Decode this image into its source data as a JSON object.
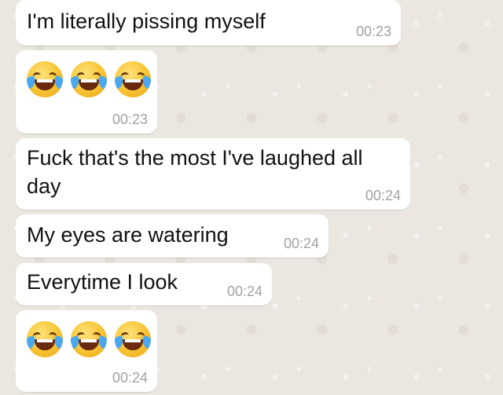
{
  "messages": [
    {
      "text": "I'm literally pissing myself",
      "time": "00:23"
    },
    {
      "emoji": [
        "face-with-tears-of-joy",
        "face-with-tears-of-joy",
        "face-with-tears-of-joy"
      ],
      "time": "00:23"
    },
    {
      "text_line1": "Fuck that's the most I've laughed all",
      "text_line2": "day",
      "time": "00:24"
    },
    {
      "text": "My eyes are watering",
      "time": "00:24"
    },
    {
      "text": "Everytime I look",
      "time": "00:24"
    },
    {
      "emoji": [
        "face-with-tears-of-joy",
        "face-with-tears-of-joy",
        "face-with-tears-of-joy"
      ],
      "time": "00:24"
    }
  ],
  "colors": {
    "bubble": "#ffffff",
    "background": "#ece5dd",
    "timestamp": "#a2a2a2",
    "text": "#111111"
  }
}
